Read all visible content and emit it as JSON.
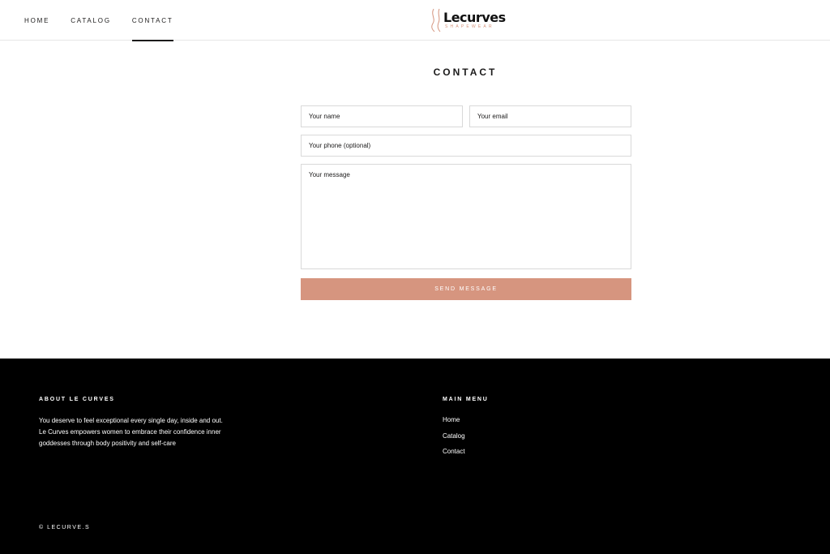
{
  "header": {
    "nav": [
      {
        "label": "HOME"
      },
      {
        "label": "CATALOG"
      },
      {
        "label": "CONTACT"
      }
    ],
    "logo": {
      "name": "Lecurves",
      "sub": "SHAPEWEAR"
    }
  },
  "main": {
    "title": "CONTACT",
    "form": {
      "name_placeholder": "Your name",
      "email_placeholder": "Your email",
      "phone_placeholder": "Your phone (optional)",
      "message_placeholder": "Your message",
      "submit_label": "SEND MESSAGE"
    }
  },
  "footer": {
    "about_heading": "ABOUT LE CURVES",
    "about_text": "You deserve to feel exceptional every single day, inside and out. Le Curves empowers women to embrace their confidence inner goddesses through body positivity and self-care",
    "menu_heading": "MAIN MENU",
    "menu": [
      {
        "label": "Home"
      },
      {
        "label": "Catalog"
      },
      {
        "label": "Contact"
      }
    ],
    "copyright": "© LECURVE.S"
  },
  "colors": {
    "accent": "#d6957f",
    "footer_bg": "#000000",
    "text": "#1c1b1b"
  }
}
